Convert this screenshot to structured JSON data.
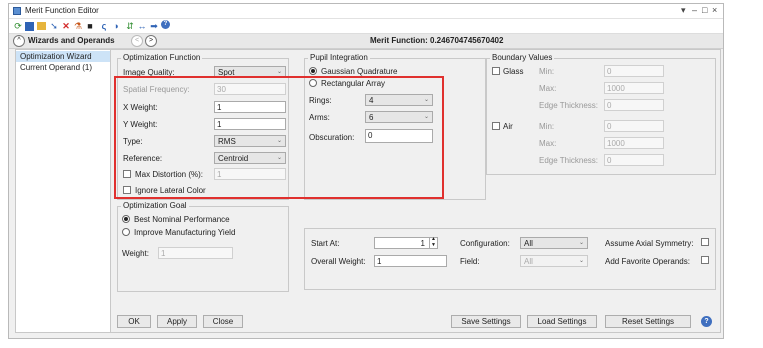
{
  "window": {
    "title": "Merit Function Editor",
    "controls": [
      "▾",
      "–",
      "□",
      "×"
    ]
  },
  "toolbar": {
    "icons": [
      "refresh-icon",
      "save-icon",
      "open-icon",
      "insert-icon",
      "delete-icon",
      "wizard-icon",
      "stop-icon",
      "color-icon",
      "toggle-icon",
      "sort-icon",
      "arrows-icon",
      "forward-icon",
      "help-icon"
    ]
  },
  "subbar": {
    "collapse_glyph": "^",
    "title": "Wizards and Operands",
    "prev_glyph": "<",
    "next_glyph": ">",
    "merit_label": "Merit Function:",
    "merit_value": "0.246704745670402"
  },
  "left_list": {
    "items": [
      "Optimization Wizard",
      "Current Operand (1)"
    ]
  },
  "opt_function": {
    "legend": "Optimization Function",
    "image_quality_label": "Image Quality:",
    "image_quality_value": "Spot",
    "spatial_freq_label": "Spatial Frequency:",
    "spatial_freq_value": "30",
    "x_weight_label": "X Weight:",
    "x_weight_value": "1",
    "y_weight_label": "Y Weight:",
    "y_weight_value": "1",
    "type_label": "Type:",
    "type_value": "RMS",
    "reference_label": "Reference:",
    "reference_value": "Centroid",
    "max_distortion_label": "Max Distortion (%):",
    "max_distortion_value": "1",
    "ignore_lateral_label": "Ignore Lateral Color"
  },
  "pupil": {
    "legend": "Pupil Integration",
    "gaussian_label": "Gaussian Quadrature",
    "rect_label": "Rectangular Array",
    "rings_label": "Rings:",
    "rings_value": "4",
    "arms_label": "Arms:",
    "arms_value": "6",
    "obscuration_label": "Obscuration:",
    "obscuration_value": "0"
  },
  "boundary": {
    "legend": "Boundary Values",
    "glass_label": "Glass",
    "air_label": "Air",
    "min_label": "Min:",
    "max_label": "Max:",
    "edge_label": "Edge Thickness:",
    "glass_min": "0",
    "glass_max": "1000",
    "glass_edge": "0",
    "air_min": "0",
    "air_max": "1000",
    "air_edge": "0"
  },
  "goal": {
    "legend": "Optimization Goal",
    "best_nominal_label": "Best Nominal Performance",
    "improve_label": "Improve Manufacturing Yield",
    "weight_label": "Weight:",
    "weight_value": "1"
  },
  "bottom_group": {
    "start_at_label": "Start At:",
    "start_at_value": "1",
    "overall_weight_label": "Overall Weight:",
    "overall_weight_value": "1",
    "configuration_label": "Configuration:",
    "configuration_value": "All",
    "field_label": "Field:",
    "field_value": "All",
    "axial_symmetry_label": "Assume Axial Symmetry:",
    "favorite_operands_label": "Add Favorite Operands:"
  },
  "buttons": {
    "ok": "OK",
    "apply": "Apply",
    "close": "Close",
    "save_settings": "Save Settings",
    "load_settings": "Load Settings",
    "reset_settings": "Reset Settings",
    "help_glyph": "?"
  },
  "colors": {
    "highlight_box": "#e0302e",
    "selected_item": "#cde3f7",
    "accent_blue": "#3f6fbf"
  }
}
